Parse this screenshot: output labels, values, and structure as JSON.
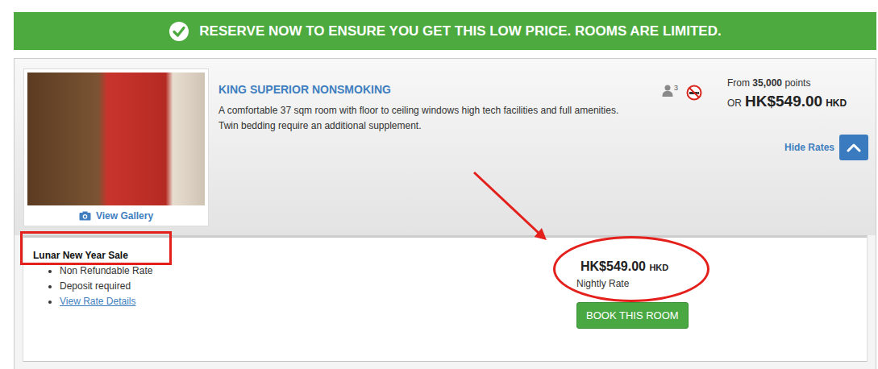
{
  "banner": {
    "text": "RESERVE NOW TO ENSURE YOU GET THIS LOW PRICE. ROOMS ARE LIMITED."
  },
  "room": {
    "title": "KING SUPERIOR NONSMOKING",
    "description": "A comfortable 37 sqm room with floor to ceiling windows high tech facilities and full amenities. Twin bedding require an additional supplement.",
    "occupancy": "3",
    "nonsmoking": true,
    "gallery_link": "View Gallery",
    "points_prefix": "From",
    "points": "35,000",
    "points_suffix": "points",
    "or_label": "OR",
    "price": "HK$549.00",
    "currency": "HKD",
    "rates_toggle": {
      "label": "Hide Rates",
      "expanded": true
    }
  },
  "rates": [
    {
      "name": "Lunar New Year Sale",
      "features": [
        "Non Refundable Rate",
        "Deposit required"
      ],
      "details_link": "View Rate Details",
      "price": "HK$549.00",
      "currency": "HKD",
      "price_label": "Nightly Rate",
      "button": "BOOK THIS ROOM"
    }
  ],
  "annotations": [
    {
      "kind": "rectangle"
    },
    {
      "kind": "arrow"
    },
    {
      "kind": "ellipse"
    }
  ]
}
